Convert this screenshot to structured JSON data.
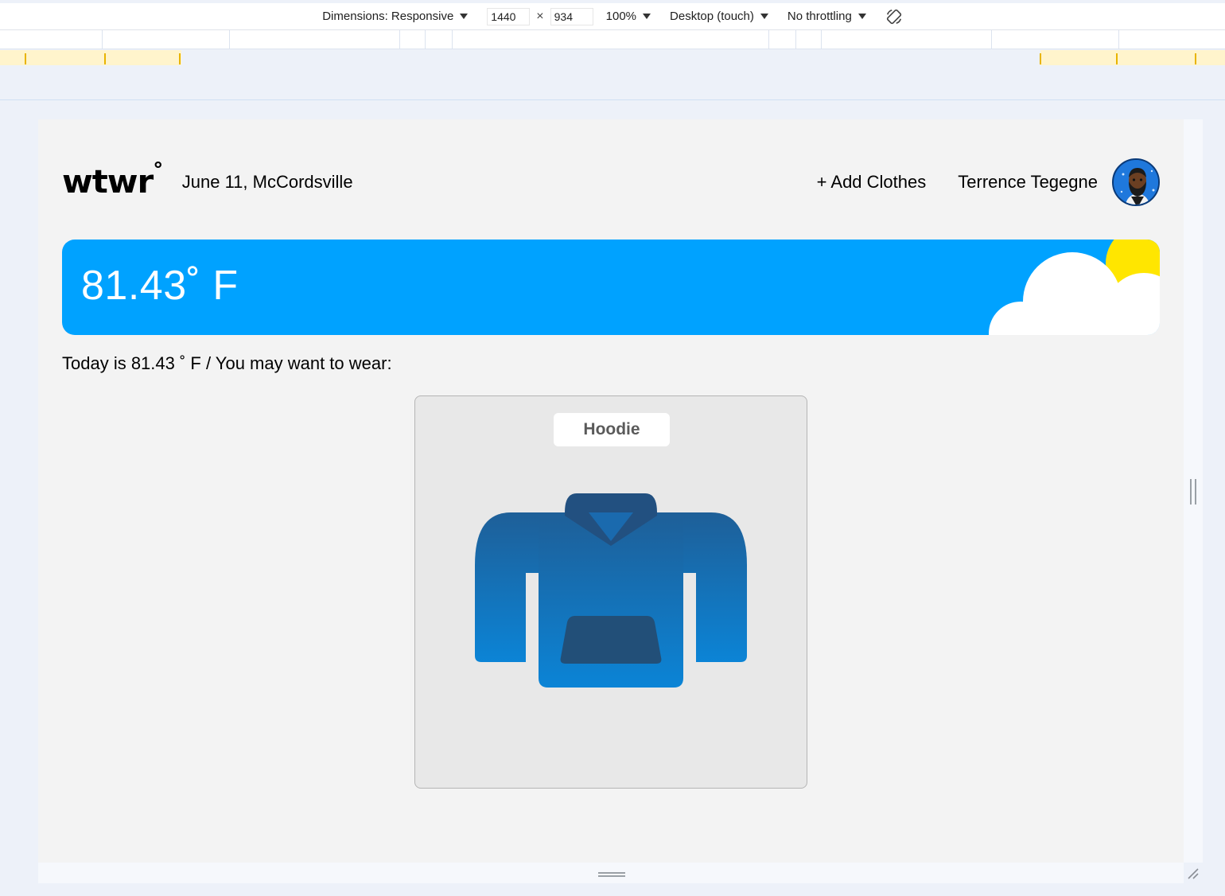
{
  "devtools": {
    "dimensions_label": "Dimensions: Responsive",
    "width_value": "1440",
    "height_value": "934",
    "times": "×",
    "zoom": "100%",
    "device": "Desktop (touch)",
    "throttling": "No throttling"
  },
  "header": {
    "logo": "wtwr",
    "date_location": "June 11, McCordsville",
    "add_clothes": "+ Add Clothes",
    "user_name": "Terrence Tegegne"
  },
  "weather": {
    "temperature": "81.43˚ F",
    "condition_icon": "sun-cloud-icon",
    "card_color": "#00a2ff"
  },
  "main": {
    "today_text": "Today is 81.43 ˚ F / You may want to wear:"
  },
  "items": [
    {
      "name": "Hoodie",
      "icon": "hoodie-icon"
    }
  ],
  "colors": {
    "accent_blue": "#00a2ff",
    "sun_yellow": "#ffe600",
    "page_bg": "#f3f3f3"
  }
}
